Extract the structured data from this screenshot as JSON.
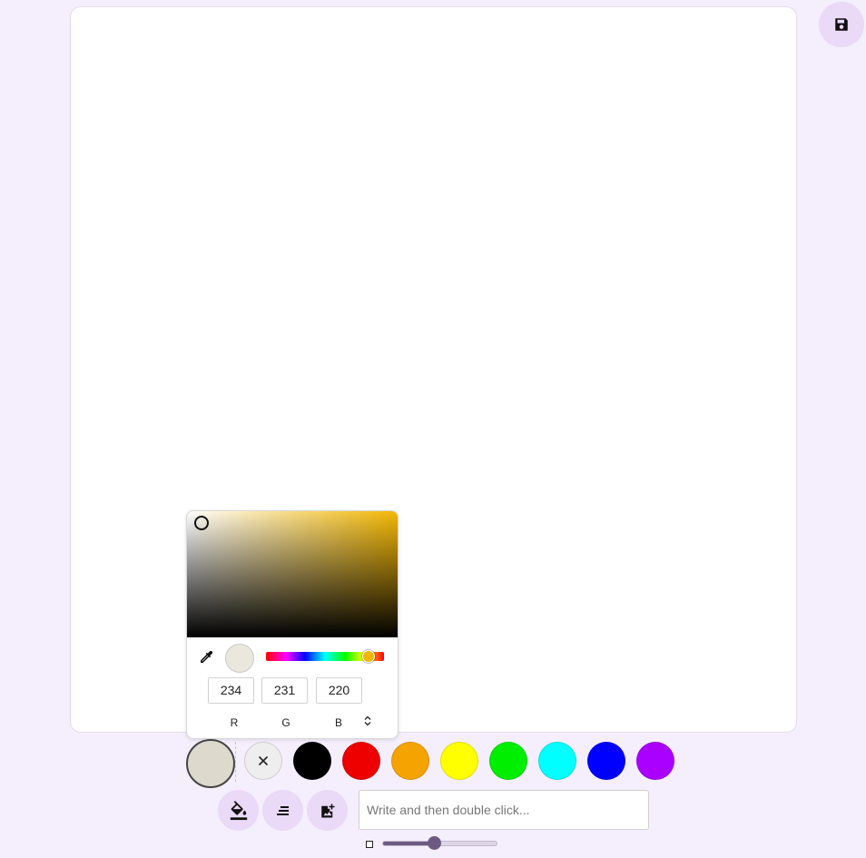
{
  "toolbar": {
    "save_icon": "floppy-disk-icon"
  },
  "color_picker": {
    "hue_color": "#f2b705",
    "selected_color": "#eae7dc",
    "r": "234",
    "g": "231",
    "b": "220",
    "r_label": "R",
    "g_label": "G",
    "b_label": "B",
    "eyedropper_icon": "eyedropper-icon",
    "mode_toggle_icon": "up-down-arrows-icon"
  },
  "palette": {
    "current_color": "#ddd9cc",
    "clear_icon": "close-icon",
    "colors": [
      "#000000",
      "#ee0000",
      "#f5a300",
      "#ffff00",
      "#00ee00",
      "#00ffff",
      "#0000ff",
      "#aa00ff"
    ]
  },
  "tools": {
    "fill_icon": "fill-bucket-icon",
    "text_align_icon": "text-align-icon",
    "add_image_icon": "add-image-icon",
    "text_placeholder": "Write and then double click...",
    "brush_size": 0.45
  }
}
